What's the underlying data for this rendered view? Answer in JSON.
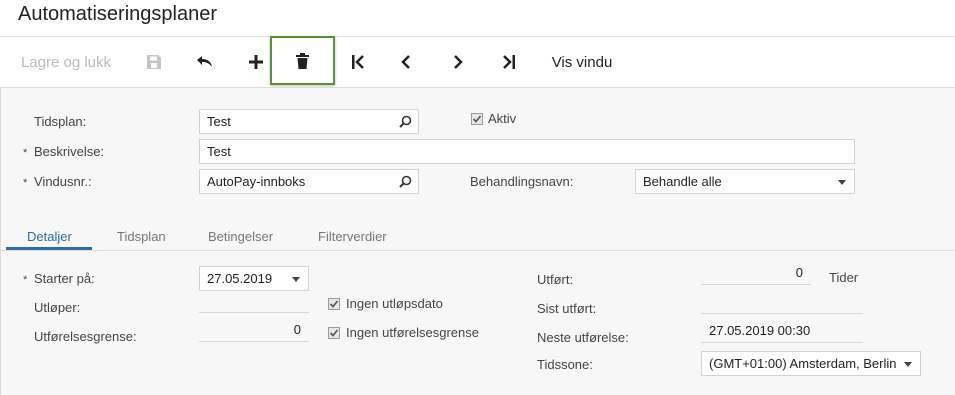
{
  "page": {
    "title": "Automatiseringsplaner"
  },
  "toolbar": {
    "save_close_label": "Lagre og lukk",
    "save_icon": "save-icon",
    "undo_icon": "undo-icon",
    "add_icon": "plus-icon",
    "delete_icon": "trash-icon",
    "first_icon": "first-record-icon",
    "prev_icon": "chevron-left-icon",
    "next_icon": "chevron-right-icon",
    "last_icon": "last-record-icon",
    "view_window_label": "Vis vindu"
  },
  "form": {
    "schedule_label": "Tidsplan:",
    "schedule_value": "Test",
    "active_label": "Aktiv",
    "active_checked": true,
    "description_label": "Beskrivelse:",
    "description_value": "Test",
    "window_label": "Vindusnr.:",
    "window_value": "AutoPay-innboks",
    "action_label": "Behandlingsnavn:",
    "action_value": "Behandle alle",
    "required_mark": "*"
  },
  "tabs": [
    {
      "label": "Detaljer",
      "active": true
    },
    {
      "label": "Tidsplan",
      "active": false
    },
    {
      "label": "Betingelser",
      "active": false
    },
    {
      "label": "Filterverdier",
      "active": false
    }
  ],
  "details": {
    "starts_on_label": "Starter på:",
    "starts_on_value": "27.05.2019",
    "expires_label": "Utløper:",
    "expires_value": "",
    "no_expiry_label": "Ingen utløpsdato",
    "no_expiry_checked": true,
    "exec_limit_label": "Utførelsesgrense:",
    "exec_limit_value": "0",
    "no_exec_limit_label": "Ingen utførelsesgrense",
    "no_exec_limit_checked": true,
    "executed_label": "Utført:",
    "executed_value": "0",
    "times_label": "Tider",
    "last_executed_label": "Sist utført:",
    "last_executed_value": "",
    "next_exec_label": "Neste utførelse:",
    "next_exec_value": "27.05.2019 00:30",
    "timezone_label": "Tidssone:",
    "timezone_value": "(GMT+01:00) Amsterdam, Berlin"
  },
  "colors": {
    "accent": "#2e6da4",
    "highlight_border": "#5f8f3a"
  }
}
